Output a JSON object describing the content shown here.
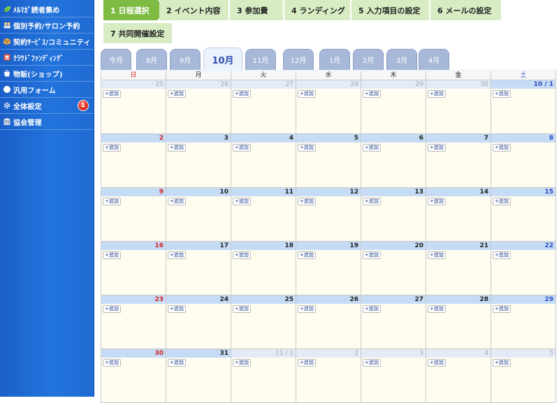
{
  "sidebar": {
    "items": [
      {
        "label": "ﾒﾙﾏｶﾞ読者集め",
        "icon": "leaf-icon",
        "name": "sidebar-item-mailmag"
      },
      {
        "label": "個別予約/サロン予約",
        "icon": "people-icon",
        "name": "sidebar-item-reservation"
      },
      {
        "label": "契約ｻｰﾋﾞｽ/コミュニティ",
        "icon": "box-icon",
        "name": "sidebar-item-contract"
      },
      {
        "label": "ｸﾗｳﾄﾞﾌｧﾝﾃﾞｨﾝｸﾞ",
        "icon": "funding-icon",
        "name": "sidebar-item-crowdfunding"
      },
      {
        "label": "物販(ショップ)",
        "icon": "shop-icon",
        "name": "sidebar-item-shop"
      },
      {
        "label": "汎用フォーム",
        "icon": "form-icon",
        "name": "sidebar-item-form"
      },
      {
        "label": "全体設定",
        "icon": "gear-icon",
        "name": "sidebar-item-settings",
        "badge": "1"
      },
      {
        "label": "協会管理",
        "icon": "building-icon",
        "name": "sidebar-item-association"
      }
    ]
  },
  "steps": [
    {
      "label": "1 日程選択",
      "active": true
    },
    {
      "label": "2 イベント内容"
    },
    {
      "label": "3 参加費"
    },
    {
      "label": "4 ランディング"
    },
    {
      "label": "5 入力項目の設定"
    },
    {
      "label": "6 メールの設定"
    },
    {
      "label": "7 共同開催設定"
    }
  ],
  "months": [
    "今月",
    "8月",
    "9月",
    "10月",
    "11月",
    "12月",
    "1月",
    "2月",
    "3月",
    "4月"
  ],
  "active_month": "10月",
  "weekdays": [
    "日",
    "月",
    "火",
    "水",
    "木",
    "金",
    "土"
  ],
  "add_label": "+追加",
  "weeks": [
    [
      {
        "d": "25",
        "o": true
      },
      {
        "d": "26",
        "o": true
      },
      {
        "d": "27",
        "o": true
      },
      {
        "d": "28",
        "o": true
      },
      {
        "d": "29",
        "o": true
      },
      {
        "d": "30",
        "o": true
      },
      {
        "d": "10 / 1"
      }
    ],
    [
      {
        "d": "2"
      },
      {
        "d": "3"
      },
      {
        "d": "4"
      },
      {
        "d": "5"
      },
      {
        "d": "6"
      },
      {
        "d": "7"
      },
      {
        "d": "8"
      }
    ],
    [
      {
        "d": "9"
      },
      {
        "d": "10"
      },
      {
        "d": "11"
      },
      {
        "d": "12"
      },
      {
        "d": "13"
      },
      {
        "d": "14"
      },
      {
        "d": "15"
      }
    ],
    [
      {
        "d": "16"
      },
      {
        "d": "17"
      },
      {
        "d": "18"
      },
      {
        "d": "19"
      },
      {
        "d": "20"
      },
      {
        "d": "21"
      },
      {
        "d": "22"
      }
    ],
    [
      {
        "d": "23"
      },
      {
        "d": "24"
      },
      {
        "d": "25"
      },
      {
        "d": "26"
      },
      {
        "d": "27"
      },
      {
        "d": "28"
      },
      {
        "d": "29"
      }
    ],
    [
      {
        "d": "30"
      },
      {
        "d": "31"
      },
      {
        "d": "11 / 1",
        "o": true
      },
      {
        "d": "2",
        "o": true
      },
      {
        "d": "3",
        "o": true
      },
      {
        "d": "4",
        "o": true
      },
      {
        "d": "5",
        "o": true
      }
    ]
  ],
  "colors": {
    "sidebar": "#1f6ad3",
    "step_active": "#7dbb42",
    "step_inactive": "#d8ecc4",
    "month_tab": "#a8b8d8",
    "sunday": "#d02020",
    "saturday": "#2a4bc0",
    "date_header": "#c6dcf6",
    "cell_bg": "#fffdf0",
    "badge": "#d81e12"
  }
}
